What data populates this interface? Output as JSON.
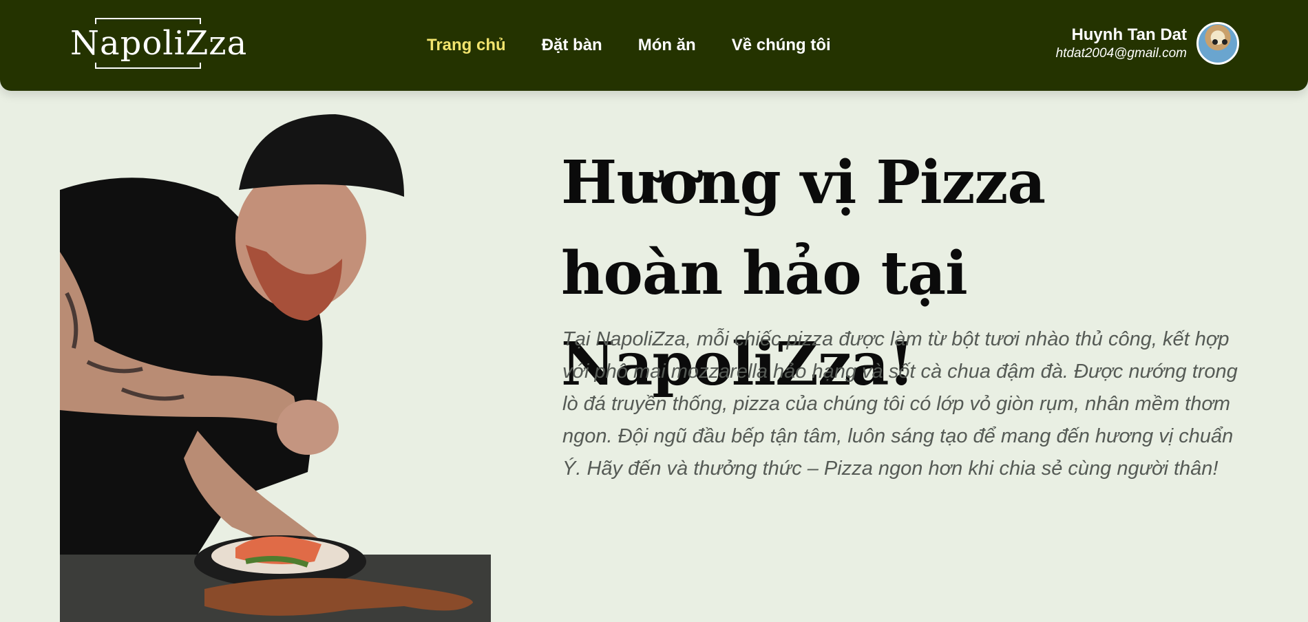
{
  "brand": {
    "logo": "NapoliZza"
  },
  "nav": {
    "items": [
      {
        "label": "Trang chủ",
        "active": true
      },
      {
        "label": "Đặt bàn",
        "active": false
      },
      {
        "label": "Món ăn",
        "active": false
      },
      {
        "label": "Về chúng tôi",
        "active": false
      }
    ]
  },
  "user": {
    "name": "Huynh Tan Dat",
    "email": "htdat2004@gmail.com"
  },
  "hero": {
    "title": "Hương vị Pizza hoàn hảo tại NapoliZza!",
    "description": "Tại NapoliZza, mỗi chiếc pizza được làm từ bột tươi nhào thủ công, kết hợp với phô mai mozzarella hảo hạng và sốt cà chua đậm đà. Được nướng trong lò đá truyền thống, pizza của chúng tôi có lớp vỏ giòn rụm, nhân mềm thơm ngon. Đội ngũ đầu bếp tận tâm, luôn sáng tạo để mang đến hương vị chuẩn Ý. Hãy đến và thưởng thức – Pizza ngon hơn khi chia sẻ cùng người thân!"
  },
  "colors": {
    "header_bg": "#243300",
    "page_bg": "#e9efe3",
    "nav_active": "#f2e46e",
    "nav_text": "#ffffff",
    "title_text": "#0b0b0b",
    "desc_text": "#555a55"
  }
}
